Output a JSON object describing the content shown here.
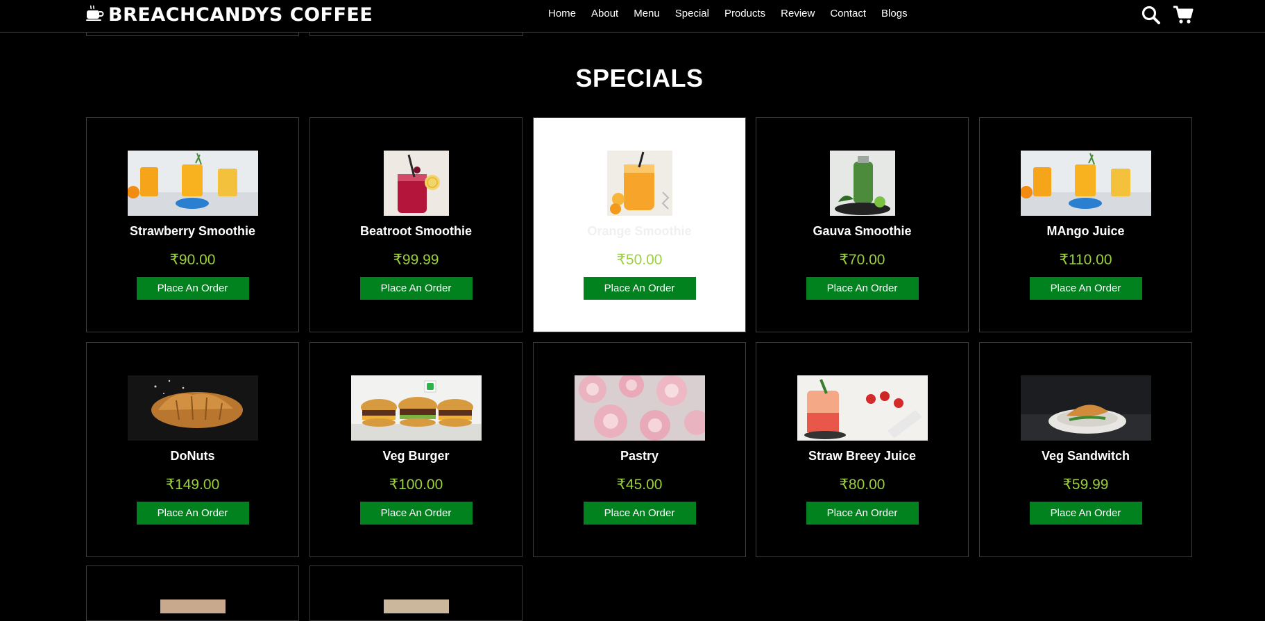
{
  "header": {
    "brand": "BREACHCANDYS COFFEE",
    "nav": [
      "Home",
      "About",
      "Menu",
      "Special",
      "Products",
      "Review",
      "Contact",
      "Blogs"
    ],
    "icons": [
      "coffee-cup-icon",
      "search-icon",
      "cart-icon"
    ]
  },
  "section": {
    "title": "SPECIALS"
  },
  "products": [
    {
      "name": "Strawberry Smoothie",
      "price": "₹90.00",
      "button": "Place An Order",
      "image": "juice-glasses"
    },
    {
      "name": "Beatroot Smoothie",
      "price": "₹99.99",
      "button": "Place An Order",
      "image": "berry-jar"
    },
    {
      "name": "Orange Smoothie",
      "price": "₹50.00",
      "button": "Place An Order",
      "image": "orange-glass"
    },
    {
      "name": "Gauva Smoothie",
      "price": "₹70.00",
      "button": "Place An Order",
      "image": "green-bottle"
    },
    {
      "name": "MAngo Juice",
      "price": "₹110.00",
      "button": "Place An Order",
      "image": "juice-glasses"
    },
    {
      "name": "DoNuts",
      "price": "₹149.00",
      "button": "Place An Order",
      "image": "croissant"
    },
    {
      "name": "Veg Burger",
      "price": "₹100.00",
      "button": "Place An Order",
      "image": "burgers"
    },
    {
      "name": "Pastry",
      "price": "₹45.00",
      "button": "Place An Order",
      "image": "meringues"
    },
    {
      "name": "Straw Breey Juice",
      "price": "₹80.00",
      "button": "Place An Order",
      "image": "strawberry-drink"
    },
    {
      "name": "Veg Sandwitch",
      "price": "₹59.99",
      "button": "Place An Order",
      "image": "sandwich-plate"
    }
  ],
  "colors": {
    "background": "#000000",
    "button": "#02821f",
    "price": "#9bd13b",
    "border": "#3c3c3c"
  }
}
